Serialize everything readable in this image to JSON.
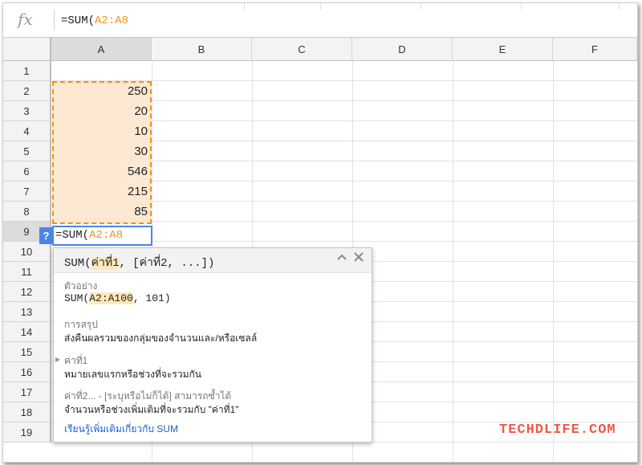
{
  "formula_bar": {
    "fx_symbol": "fx",
    "prefix": "=SUM(",
    "range_ref": "A2:A8"
  },
  "columns": [
    "A",
    "B",
    "C",
    "D",
    "E",
    "F"
  ],
  "rows": [
    "1",
    "2",
    "3",
    "4",
    "5",
    "6",
    "7",
    "8",
    "9",
    "10",
    "11",
    "12",
    "13",
    "14",
    "15",
    "16",
    "17",
    "18",
    "19"
  ],
  "cells_a": [
    "",
    "250",
    "20",
    "10",
    "30",
    "546",
    "215",
    "85"
  ],
  "edit_cell": {
    "help_label": "?",
    "prefix": "=SUM(",
    "range_ref": "A2:A8"
  },
  "popup": {
    "sig_name": "SUM(",
    "sig_arg1": "ค่าที่1",
    "sig_rest": ", [ค่าที่2, ...])",
    "example_label": "ตัวอย่าง",
    "example_fn": "SUM(",
    "example_range": "A2:A100",
    "example_rest": ", 101)",
    "summary_label": "การสรุป",
    "summary_text": "ส่งคืนผลรวมของกลุ่มของจำนวนและ/หรือเซลล์",
    "arg1_label": "ค่าที่1",
    "arg1_text": "หมายเลขแรกหรือช่วงที่จะรวมกัน",
    "arg2_label": "ค่าที่2... - [ระบุหรือไม่ก็ได้] สามารถซ้ำได้",
    "arg2_text": "จำนวนหรือช่วงเพิ่มเติมที่จะรวมกับ \"ค่าที่1\"",
    "learn_more": "เรียนรู้เพิ่มเติมเกี่ยวกับ SUM",
    "collapse_icon": "chevron-up-icon",
    "close_icon": "close-icon"
  },
  "watermark": "TECHDLIFE.COM",
  "colors": {
    "range_highlight": "#f09310",
    "range_fill": "#fde9d3",
    "edit_border": "#4a85e8",
    "link": "#1a5fd0",
    "watermark": "#ee5a45"
  }
}
